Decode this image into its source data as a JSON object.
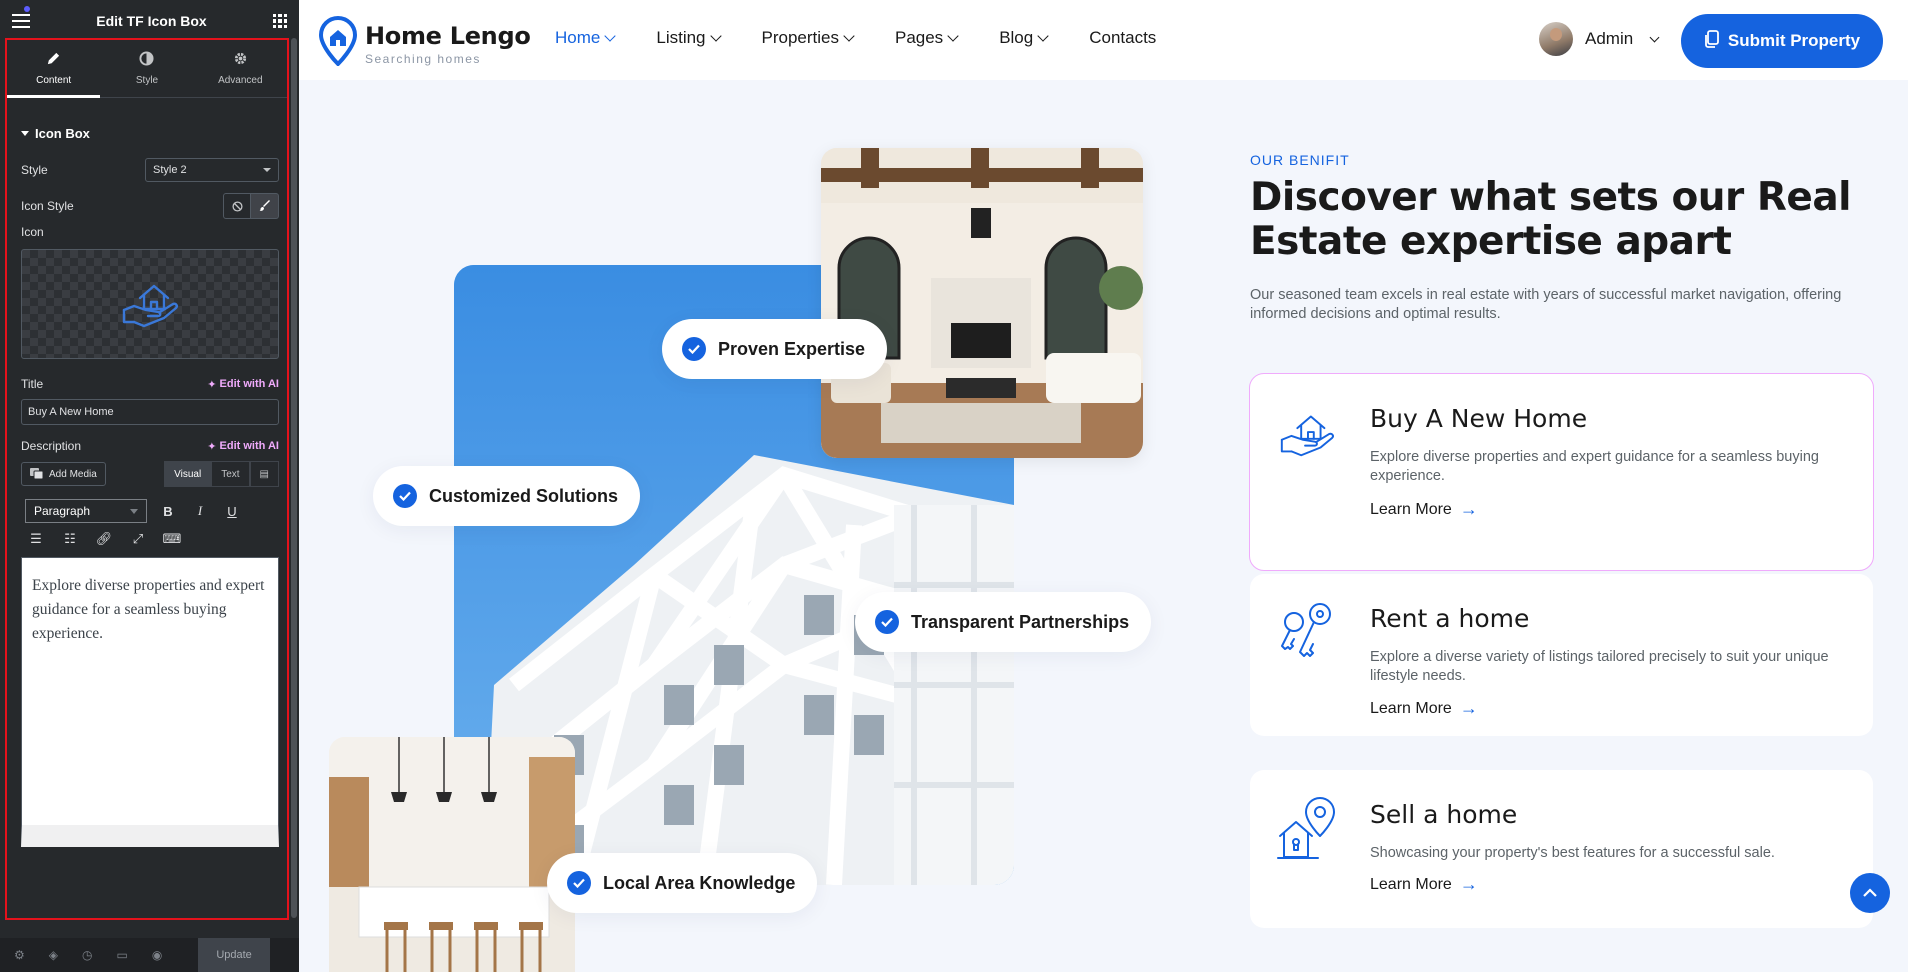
{
  "panel": {
    "title": "Edit TF Icon Box",
    "tabs": [
      {
        "label": "Content",
        "icon": "pencil-icon"
      },
      {
        "label": "Style",
        "icon": "contrast-icon"
      },
      {
        "label": "Advanced",
        "icon": "gear-icon"
      }
    ],
    "section": "Icon Box",
    "style_label": "Style",
    "style_value": "Style 2",
    "icon_style_label": "Icon Style",
    "icon_label": "Icon",
    "title_label": "Title",
    "edit_ai": "Edit with AI",
    "title_value": "Buy A New Home",
    "description_label": "Description",
    "add_media": "Add Media",
    "visual_tab": "Visual",
    "text_tab": "Text",
    "format_value": "Paragraph",
    "editor_text": "Explore diverse properties and expert guidance for a seamless buying experience.",
    "footer_update": "Update"
  },
  "site": {
    "logo_name": "Home Lengo",
    "logo_tagline": "Searching homes",
    "nav": [
      "Home",
      "Listing",
      "Properties",
      "Pages",
      "Blog",
      "Contacts"
    ],
    "admin": "Admin",
    "submit": "Submit Property",
    "badges": [
      "Proven Expertise",
      "Customized Solutions",
      "Transparent Partnerships",
      "Local Area Knowledge"
    ],
    "subtitle": "OUR BENIFIT",
    "title": "Discover what sets our Real Estate expertise apart",
    "intro": "Our seasoned team excels in real estate with years of successful market navigation, offering informed decisions and optimal results.",
    "cards": [
      {
        "title": "Buy A New Home",
        "desc": "Explore diverse properties and expert guidance for a seamless buying experience.",
        "link": "Learn More",
        "icon": "house-hand-icon"
      },
      {
        "title": "Rent a home",
        "desc": "Explore a diverse variety of listings tailored precisely to suit your unique lifestyle needs.",
        "link": "Learn More",
        "icon": "keys-icon"
      },
      {
        "title": "Sell a home",
        "desc": "Showcasing your property's best features for a successful sale.",
        "link": "Learn More",
        "icon": "map-pin-house-icon"
      }
    ],
    "accent": "#1563df",
    "selection_outline": "#f0abfc",
    "panel_frame": "#e4121c"
  }
}
